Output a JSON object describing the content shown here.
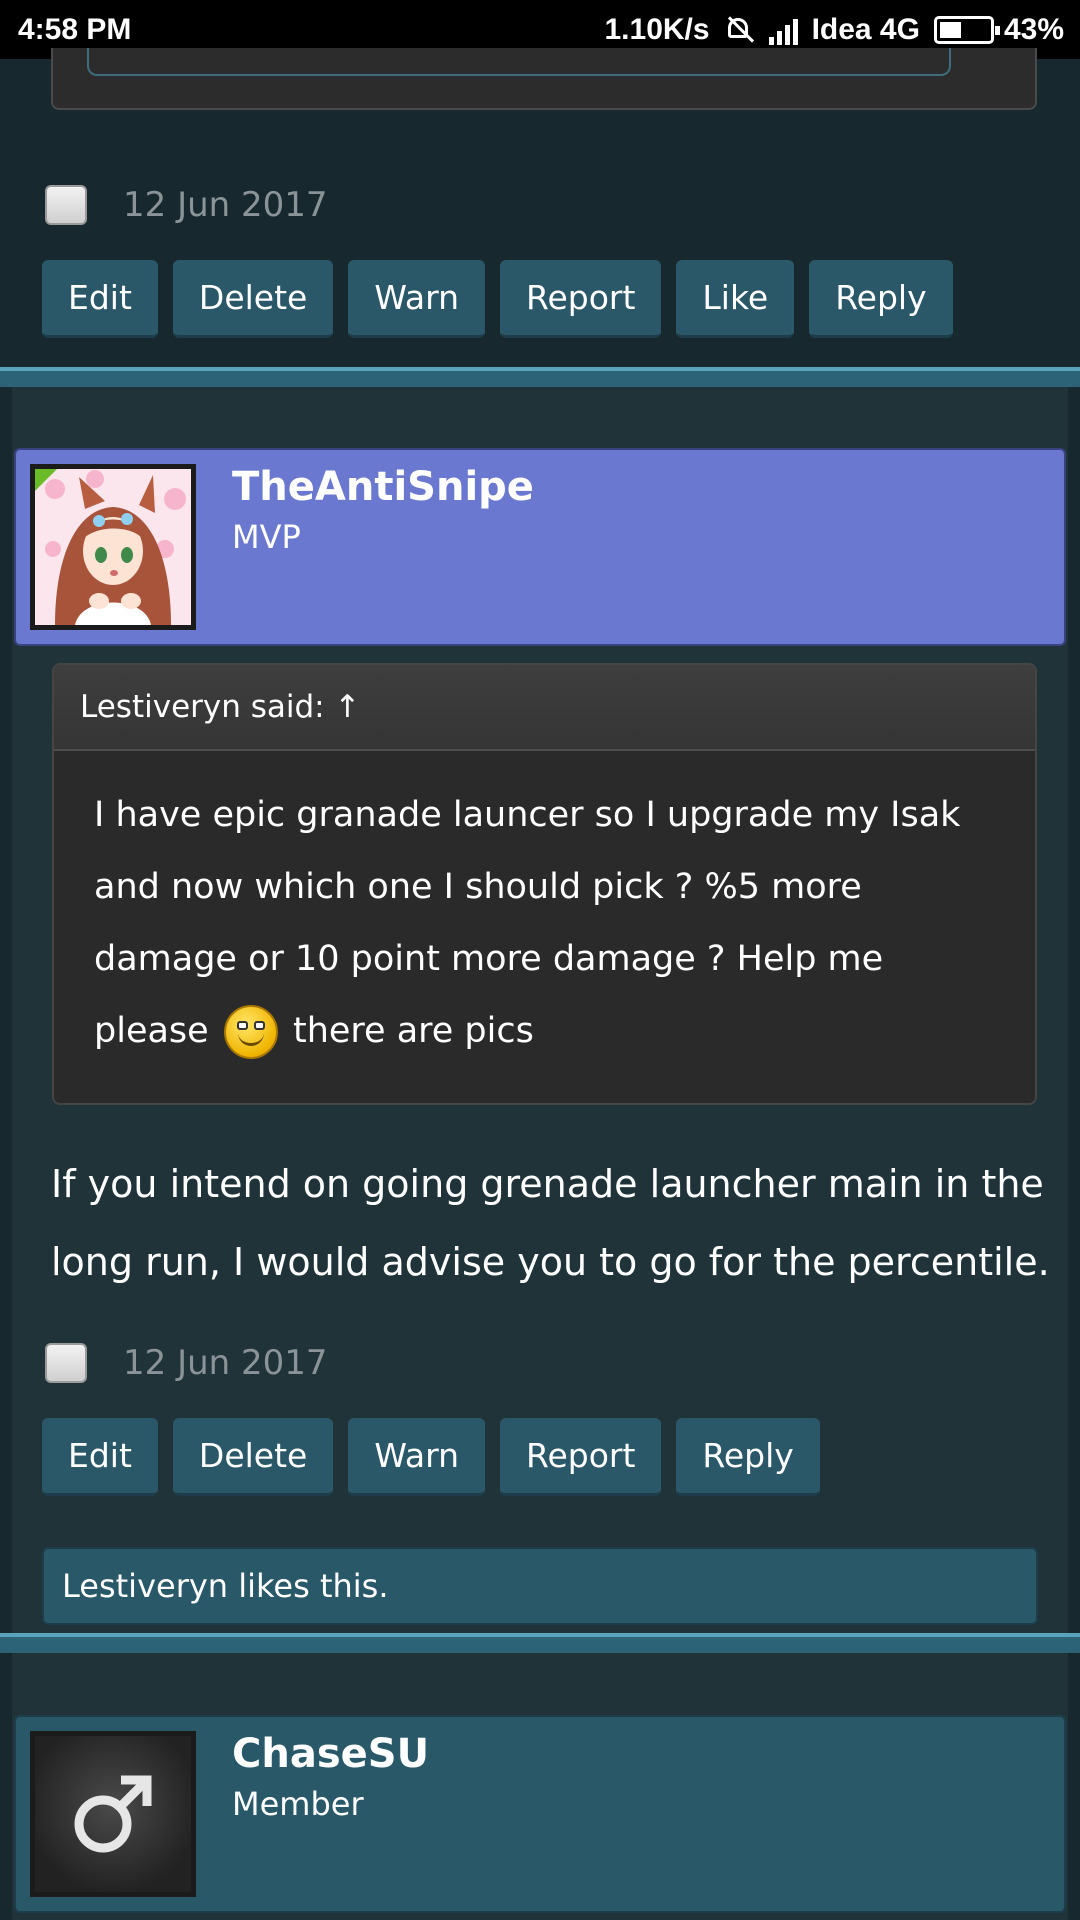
{
  "status_bar": {
    "time": "4:58 PM",
    "speed": "1.10K/s",
    "carrier": "Idea 4G",
    "battery": "43%",
    "battery_level": 0.43
  },
  "post1": {
    "date": "12 Jun 2017",
    "actions": [
      "Edit",
      "Delete",
      "Warn",
      "Report",
      "Like",
      "Reply"
    ]
  },
  "post2": {
    "username": "TheAntiSnipe",
    "user_title": "MVP",
    "quote": {
      "author_line": "Lestiveryn said: ↑",
      "text_before": "I have epic granade launcer so I upgrade my Isak and now which one I should pick ? %5 more damage or 10 point more damage ? Help me please",
      "text_after": "there are pics",
      "smiley": "smiley-icon"
    },
    "body": "If you intend on going grenade launcher main in the long run, I would advise you to go for the percentile.",
    "date": "12 Jun 2017",
    "actions": [
      "Edit",
      "Delete",
      "Warn",
      "Report",
      "Reply"
    ],
    "likes": "Lestiveryn likes this."
  },
  "post3": {
    "username": "ChaseSU",
    "user_title": "Member",
    "avatar_icon": "male-symbol-icon"
  },
  "colors": {
    "background": "#17292f",
    "button": "#2b5869",
    "mvp_bar": "#6a78cf",
    "divider": "#2c6377"
  }
}
